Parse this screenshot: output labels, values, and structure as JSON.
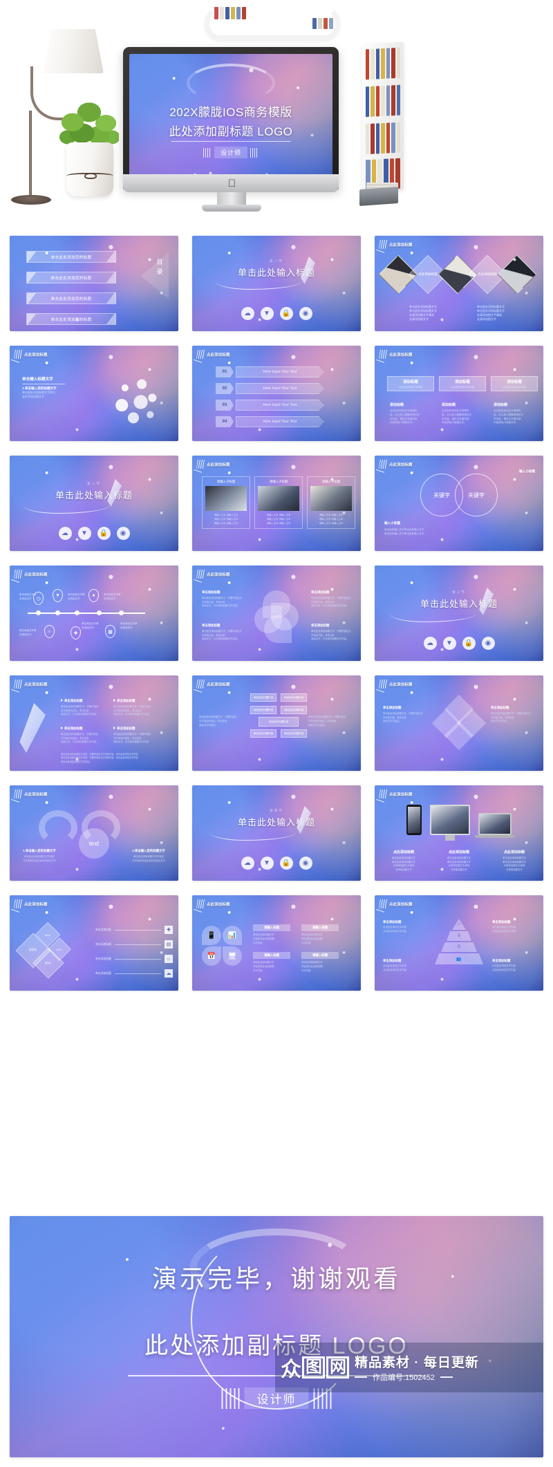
{
  "hero": {
    "title": "202X朦胧IOS商务模版",
    "subtitle": "此处添加副标题  LOGO",
    "badge": "设计师"
  },
  "final": {
    "title": "演示完毕，谢谢观看",
    "subtitle": "此处添加副标题  LOGO",
    "badge": "设计师"
  },
  "watermark": {
    "logo_part1": "众",
    "logo_part2": "图",
    "logo_part3": "网",
    "tagline": "精品素材 · 每日更新",
    "work_no": "作品编号:1502452"
  },
  "common": {
    "corner_label": "点此添加标题",
    "section_kicker": "第一节",
    "section_title": "单击此处输入标题",
    "icon_cloud": "cloud-icon",
    "icon_download": "download-icon",
    "icon_lock": "lock-icon",
    "icon_wifi": "wifi-icon"
  },
  "slides": [
    {
      "n": 1,
      "name": "agenda-slide",
      "chev_label": "目录",
      "bars": [
        "单击此处添加您的标题",
        "单击此处添加您的标题",
        "单击此处添加您的标题",
        "单击此处添加您的标题"
      ]
    },
    {
      "n": 2,
      "name": "section-divider-1",
      "kicker": "第一节",
      "title": "单击此处输入标题"
    },
    {
      "n": 3,
      "name": "diamond-photos-slide",
      "corner": "点此添加标题",
      "diamond_labels": [
        "点此添加标题",
        "点此添加标题"
      ],
      "captions": [
        "单击此处添加标题文字\n单击此处添加标题文字\n长清添加图文手事成\n长清添加图文字",
        "单击此处添加标题文字\n单击此处添加标题文字\n长清添加图文手事成\n长清添加图文字"
      ]
    },
    {
      "n": 4,
      "name": "icon-ball-slide",
      "corner": "点此添加标题",
      "heading": "单击输入标题文字",
      "sub": "1.单击输入您的标题文字",
      "body": "单击此处添加标题文字单击\n此处添加标题文字"
    },
    {
      "n": 5,
      "name": "numbered-list-slide",
      "corner": "点此添加标题",
      "rows": [
        {
          "num": "01",
          "text": "Here Input Your Text"
        },
        {
          "num": "02",
          "text": "Here Input Your Text"
        },
        {
          "num": "03",
          "text": "Here Input Your Text"
        },
        {
          "num": "04",
          "text": "Here Input Your Text"
        }
      ]
    },
    {
      "n": 6,
      "name": "three-cards-slide",
      "corner": "点此添加标题",
      "cards": [
        {
          "head": "添加标题",
          "headsub": "点击此处添加文字内容",
          "title": "添加标题",
          "body": "点击此处添加文字说明内\n容，可以表入图解说明文字\n本内容，请在文本框内添\n内容添加小段落文字。"
        },
        {
          "head": "添加标题",
          "headsub": "点击此处添加文字内容",
          "title": "添加标题",
          "body": "点击此处添加文字说明内\n容，可以表入图解说明文字\n本内容，请在文本框内添\n内容添加小段落文字。"
        },
        {
          "head": "添加标题",
          "headsub": "点击此处添加文字内容",
          "title": "添加标题",
          "body": "点击此处添加文字说明内\n容，可以表入图解说明文字\n本内容，请在文本框内添\n内容添加小段落文字。"
        }
      ]
    },
    {
      "n": 7,
      "name": "section-divider-2",
      "kicker": "第二节",
      "title": "单击此处输入标题"
    },
    {
      "n": 8,
      "name": "photo-cards-slide",
      "corner": "点此添加标题",
      "cards": [
        {
          "label": "请输入子标题",
          "caption": "请输入文本 请输入文本\n请输入文本 请输入文本\n请输入文本 请输入文本"
        },
        {
          "label": "请输入子标题",
          "caption": "请输入文本 请输入文本\n请输入文本 请输入文本\n请输入文本 请输入文本"
        },
        {
          "label": "请输入子标题",
          "caption": "请输入文本 请输入文本\n请输入文本 请输入文本\n请输入文本 请输入文本"
        }
      ]
    },
    {
      "n": 9,
      "name": "keywords-slide",
      "corner": "点此添加标题",
      "keywords": [
        "关键字",
        "关键字"
      ],
      "note_title": "输入小标题",
      "note_body": "单击此处输入文字单击此处输入文字\n单击此处输入文字单击此处输入文字"
    },
    {
      "n": 10,
      "name": "timeline-slide",
      "corner": "点此添加标题",
      "nodes": [
        "clock-icon",
        "heart-icon",
        "pin-icon",
        "bulb-icon",
        "plus-icon",
        "calendar-icon"
      ],
      "labels": [
        "单击添加文字单\n击添加文字",
        "单击添加文字单\n击添加文字",
        "单击添加文字单\n击添加文字",
        "单击添加文字单\n击添加文字",
        "单击添加文字单\n击添加文字",
        "单击添加文字单\n击添加文字"
      ]
    },
    {
      "n": 11,
      "name": "petal-cluster-slide",
      "corner": "点此添加标题",
      "items": [
        {
          "title": "单击添加标题",
          "body": "单击此处添加标题文字，中要内容区文\n字添加内容。单击此处\n添加文字。中击添加标题文字内容。"
        },
        {
          "title": "单击添加标题",
          "body": "单击此处添加标题文字，中要内容区文\n字添加内容。单击此处\n添加文字。中击添加标题文字内容。"
        },
        {
          "title": "单击添加标题",
          "body": "单击此处添加标题文字，中要内容区文\n字添加内容。单击此处\n添加文字。中击添加标题文字内容。"
        },
        {
          "title": "单击添加标题",
          "body": "单击此处添加标题文字，中要内容区文\n字添加内容。单击此处\n添加文字。中击添加标题文字内容。"
        }
      ]
    },
    {
      "n": 12,
      "name": "section-divider-3",
      "kicker": "第三节",
      "title": "单击此处输入标题"
    },
    {
      "n": 13,
      "name": "pen-bullets-slide",
      "corner": "点此添加标题",
      "bullets": [
        {
          "title": "单击添加标题",
          "body": "单击此处添加标题文字，中要内容区\n文字添加内容区。单击此处\n添加文字。中击添加标题文字内容。"
        },
        {
          "title": "单击添加标题",
          "body": "单击此处添加标题文字，中要内容区\n文字添加内容区。单击此处\n添加文字。中击添加标题文字内容。"
        },
        {
          "title": "单击添加标题",
          "body": "单击此处添加标题文字，中要内容区\n文字添加内容区。单击此处\n添加文字。中击添加标题文字内容。"
        },
        {
          "title": "单击添加标题",
          "body": "单击此处添加标题文字，中要内容区\n文字添加内容区。单击此处\n添加文字。中击添加标题文字内容。"
        }
      ],
      "footer": "单击此处添加标题文字内容，中要内容区文字添加内容。单击此处添加文字内容\n单击此处添加标题文字内容，中要内容区文字添加内容。单击此处添加文字内容\n单击此处添加标题文字内容区。"
    },
    {
      "n": 14,
      "name": "org-chart-slide",
      "corner": "点此添加标题",
      "boxes": [
        "添加此处标题内容",
        "添加此处标题内容",
        "添加此处标题内容",
        "添加此处标题内容",
        "添加此处标题内容",
        "添加此处标题内容",
        "添加此处标题内容"
      ],
      "side_left": "单击此处添加标题文字，中要内容区\n文字添加内容区。单击此处\n添加文字内容区。",
      "side_right": "单击此处添加标题文字，中要内容区\n文字添加内容区。单击此处\n添加文字内容区。"
    },
    {
      "n": 15,
      "name": "diamond-cluster-slide",
      "corner": "点此添加标题",
      "left_title": "单击添加标题",
      "left_body": "单击此处添加标题文字，中要内容区文\n字添加内容。单击此处\n添加文字内容区。",
      "right_title": "单击添加标题",
      "right_body": "单击此处添加标题文字，中要内容区文\n字添加内容。单击此处\n添加文字内容区。"
    },
    {
      "n": 16,
      "name": "arrow-text-slide",
      "corner": "点此添加标题",
      "center": "text",
      "left_title": "1.单击输入您的标题文字",
      "left_body": "单击此处添加标题文字内容区\n文字添加内容区添加内容区文字",
      "right_title": "2.单击输入您的标题文字",
      "right_body": "单击此处添加标题文字内容区\n文字添加内容区添加内容区文字"
    },
    {
      "n": 17,
      "name": "section-divider-4",
      "kicker": "第四节",
      "title": "单击此处输入标题"
    },
    {
      "n": 18,
      "name": "devices-slide",
      "corner": "点此添加标题",
      "captions": [
        {
          "title": "点此添加标题",
          "body": "单击此处添加标题文字\n单击此处添加标题文字\n长清添加图文手事成\n长清添加图文字"
        },
        {
          "title": "点此添加标题",
          "body": "单击此处添加标题文字\n单击此处添加标题文字\n长清添加图文手事成\n长清添加图文字"
        },
        {
          "title": "点此添加标题",
          "body": "单击此处添加标题文字\n单击此处添加标题文字\n长清添加图文手事成\n长清添加图文字"
        }
      ]
    },
    {
      "n": 19,
      "name": "percent-diamonds-slide",
      "corner": "点此添加标题",
      "percents": [
        "55%",
        "20%",
        "10%",
        "35%"
      ],
      "rows": [
        {
          "text": "单击添加标题",
          "icon": "plus-icon"
        },
        {
          "text": "单击添加标题",
          "icon": "book-icon"
        },
        {
          "text": "单击添加标题",
          "icon": "bulb-icon"
        },
        {
          "text": "单击添加标题",
          "icon": "cloud-icon"
        }
      ]
    },
    {
      "n": 20,
      "name": "four-quadrant-slide",
      "corner": "点此添加标题",
      "icons": [
        "phone-icon",
        "chart-icon",
        "calendar-icon",
        "monitor-icon"
      ],
      "boxes": [
        {
          "title": "请输入标题",
          "body": "请在此添加标题文字\n内容请在此添加标题\n文字内容"
        },
        {
          "title": "请输入标题",
          "body": "请在此添加标题文字\n内容请在此添加标题\n文字内容"
        },
        {
          "title": "请输入标题",
          "body": "请在此添加标题文字\n内容请在此添加标题\n文字内容"
        },
        {
          "title": "请输入标题",
          "body": "请在此添加标题文字\n内容请在此添加标题\n文字内容"
        }
      ]
    },
    {
      "n": 21,
      "name": "pyramid-slide",
      "corner": "点此添加标题",
      "levels": [
        "bulb-icon",
        "$",
        "O",
        "people-icon"
      ],
      "sides": [
        {
          "title": "单击添加标题",
          "body": "点击此处添加文字内容\n点击此处添加文字内容"
        },
        {
          "title": "单击添加标题",
          "body": "点击此处添加文字内容\n点击此处添加文字内容"
        },
        {
          "title": "单击添加标题",
          "body": "点击此处添加文字内容\n点击此处添加文字内容"
        },
        {
          "title": "单击添加标题",
          "body": "点击此处添加文字内容\n点击此处添加文字内容"
        }
      ]
    }
  ]
}
